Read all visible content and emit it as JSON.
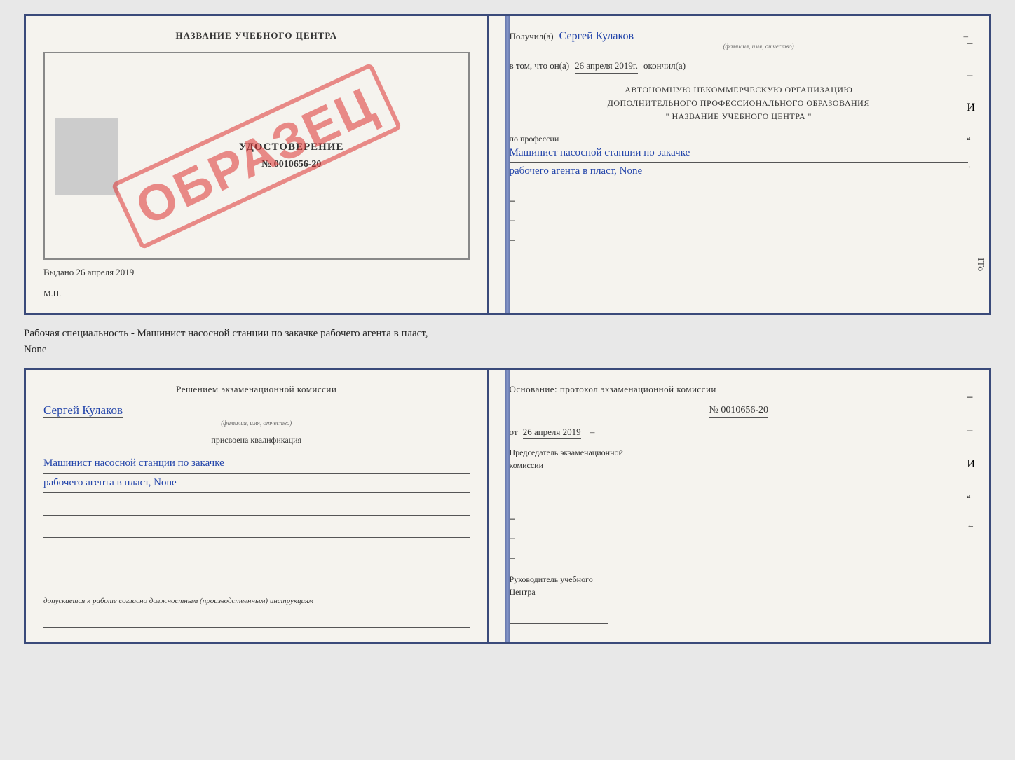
{
  "cert": {
    "top": {
      "left": {
        "title": "НАЗВАНИЕ УЧЕБНОГО ЦЕНТРА",
        "obrazec": "ОБРАЗЕЦ",
        "udostoverenie_label": "УДОСТОВЕРЕНИЕ",
        "number": "№ 0010656-20",
        "vydano_label": "Выдано",
        "vydano_date": "26 апреля 2019",
        "mp": "М.П."
      },
      "right": {
        "poluchil_label": "Получил(а)",
        "poluchil_name": "Сергей Кулаков",
        "familiya_label": "(фамилия, имя, отчество)",
        "dash1": "–",
        "v_tom_label": "в том, что он(а)",
        "date_value": "26 апреля 2019г.",
        "okonchil_label": "окончил(а)",
        "org_line1": "АВТОНОМНУЮ НЕКОММЕРЧЕСКУЮ ОРГАНИЗАЦИЮ",
        "org_line2": "ДОПОЛНИТЕЛЬНОГО ПРОФЕССИОНАЛЬНОГО ОБРАЗОВАНИЯ",
        "org_line3": "\"   НАЗВАНИЕ УЧЕБНОГО ЦЕНТРА   \"",
        "dash2": "–",
        "dash3": "–",
        "i_label": "И",
        "a_label": "а",
        "arrow_label": "←",
        "po_professii_label": "по профессии",
        "profession_line1": "Машинист насосной станции по закачке",
        "profession_line2": "рабочего агента в пласт, None",
        "dash4": "–",
        "dash5": "–",
        "dash6": "–"
      }
    },
    "middle_text_line1": "Рабочая специальность - Машинист насосной станции по закачке рабочего агента в пласт,",
    "middle_text_line2": "None",
    "bottom": {
      "left": {
        "resheniem_label": "Решением экзаменационной комиссии",
        "name_hw": "Сергей Кулаков",
        "familiya_label": "(фамилия, имя, отчество)",
        "prisvoyena_label": "присвоена квалификация",
        "profession_line1": "Машинист насосной станции по закачке",
        "profession_line2": "рабочего агента в пласт, None",
        "blank_lines": 3,
        "dopuskaetsya_prefix": "допускается к",
        "dopuskaetsya_value": "работе согласно должностным (производственным) инструкциям"
      },
      "right": {
        "osnovanie_label": "Основание: протокол экзаменационной комиссии",
        "protocol_num": "№ 0010656-20",
        "ot_label": "от",
        "ot_date": "26 апреля 2019",
        "dash1": "–",
        "dash2": "–",
        "predsedatel_label": "Председатель экзаменационной",
        "predsedatel_label2": "комиссии",
        "dash3": "–",
        "i_label": "И",
        "a_label": "а",
        "arrow_label": "←",
        "rukovoditel_label": "Руководитель учебного",
        "tsentra_label": "Центра",
        "dash4": "–",
        "dash5": "–",
        "dash6": "–"
      }
    }
  },
  "ito_label": "ITo"
}
